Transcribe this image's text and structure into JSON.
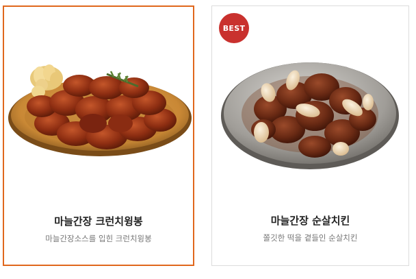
{
  "products": [
    {
      "name": "마늘간장 크런치윙봉",
      "description": "마늘간장소스를 입힌 크런치윙봉",
      "image_icon": "fried-chicken-wings-plate-image",
      "selected": true
    },
    {
      "name": "마늘간장 순살치킨",
      "description": "쫄깃한 떡을 곁들인 순살치킨",
      "image_icon": "boneless-chicken-bowl-image",
      "badge": "BEST"
    }
  ],
  "colors": {
    "selected_border": "#e0671c",
    "badge_bg": "#c9312e"
  }
}
